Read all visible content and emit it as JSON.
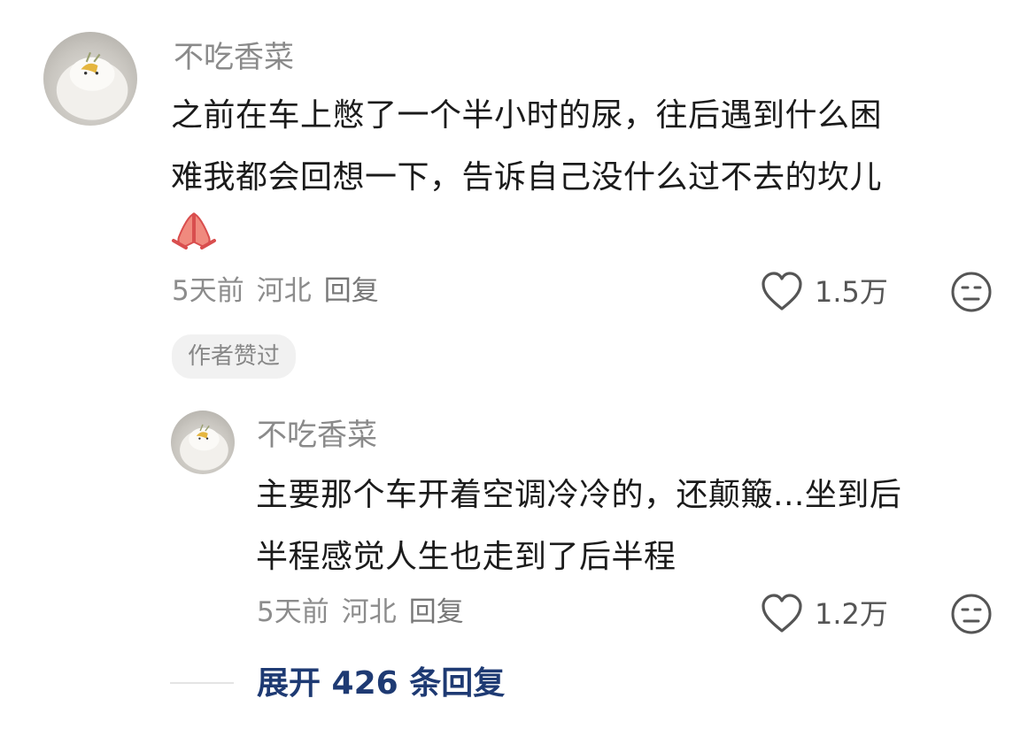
{
  "comment": {
    "username": "不吃香菜",
    "text_line1": "之前在车上憋了一个半小时的尿，往后遇到什么困",
    "text_line2": "难我都会回想一下，告诉自己没什么过不去的坎儿",
    "emoji": "pray-hands-icon",
    "time": "5天前",
    "location": "河北",
    "reply": "回复",
    "likes": "1.5万",
    "author_badge": "作者赞过"
  },
  "reply": {
    "username": "不吃香菜",
    "text_line1": "主要那个车开着空调冷冷的，还颠簸...坐到后",
    "text_line2": "半程感觉人生也走到了后半程",
    "time": "5天前",
    "location": "河北",
    "reply": "回复",
    "likes": "1.2万"
  },
  "expand_label": "展开 426 条回复",
  "colors": {
    "link": "#1e3a73",
    "muted": "#8c8c8c",
    "badge_bg": "#f1f1f1"
  }
}
